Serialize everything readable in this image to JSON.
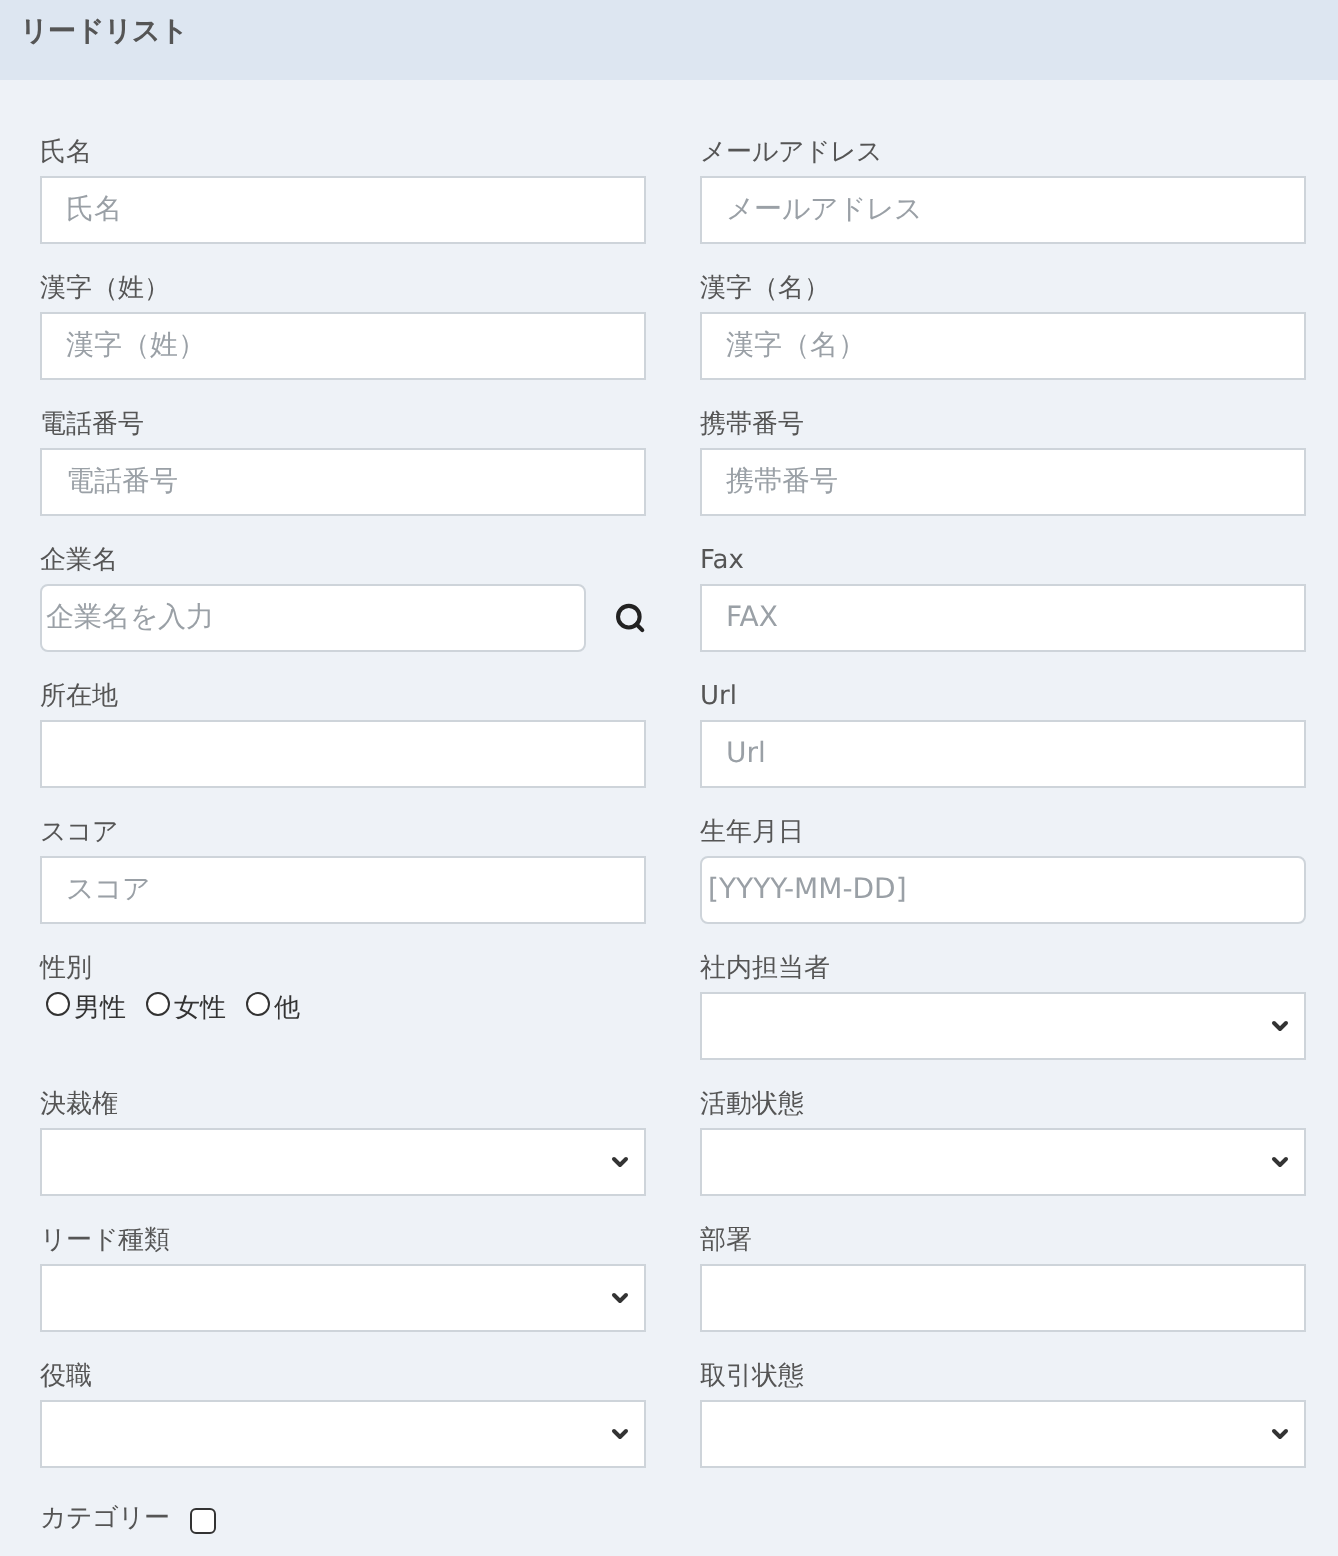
{
  "header": {
    "title": "リードリスト"
  },
  "fields": [
    {
      "kind": "text",
      "label": "氏名",
      "placeholder": "氏名"
    },
    {
      "kind": "text",
      "label": "メールアドレス",
      "placeholder": "メールアドレス"
    },
    {
      "kind": "text",
      "label": "漢字（姓）",
      "placeholder": "漢字（姓）"
    },
    {
      "kind": "text",
      "label": "漢字（名）",
      "placeholder": "漢字（名）"
    },
    {
      "kind": "text",
      "label": "電話番号",
      "placeholder": "電話番号"
    },
    {
      "kind": "text",
      "label": "携帯番号",
      "placeholder": "携帯番号"
    },
    {
      "kind": "search",
      "label": "企業名",
      "placeholder": "企業名を入力"
    },
    {
      "kind": "text",
      "label": "Fax",
      "placeholder": "FAX"
    },
    {
      "kind": "text",
      "label": "所在地"
    },
    {
      "kind": "text",
      "label": "Url",
      "placeholder": "Url"
    },
    {
      "kind": "text",
      "label": "スコア",
      "placeholder": "スコア"
    },
    {
      "kind": "date",
      "label": "生年月日",
      "placeholder": "[YYYY-MM-DD]"
    },
    {
      "kind": "radio",
      "label": "性別",
      "options": [
        {
          "label": "男性",
          "selected": false
        },
        {
          "label": "女性",
          "selected": false
        },
        {
          "label": "他",
          "selected": false
        }
      ]
    },
    {
      "kind": "select",
      "label": "社内担当者"
    },
    {
      "kind": "select",
      "label": "決裁権"
    },
    {
      "kind": "select",
      "label": "活動状態"
    },
    {
      "kind": "select",
      "label": "リード種類"
    },
    {
      "kind": "text",
      "label": "部署"
    },
    {
      "kind": "select",
      "label": "役職"
    },
    {
      "kind": "select",
      "label": "取引状態"
    },
    {
      "kind": "checkbox",
      "label": "カテゴリー",
      "checked": false
    }
  ]
}
